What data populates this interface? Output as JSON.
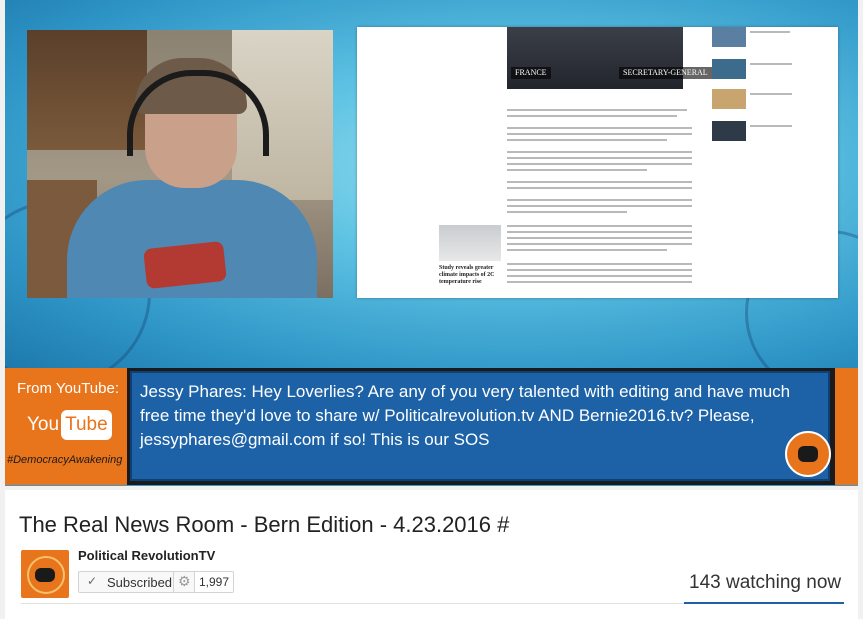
{
  "ticker": {
    "from_label": "From YouTube:",
    "brand_you": "You",
    "brand_tube": "Tube",
    "hashtag": "#DemocracyAwakening",
    "message": "Jessy Phares: Hey Loverlies? Are any of you very talented with editing and have much free time they'd love to share w/ Politicalrevolution.tv AND Bernie2016.tv? Please, jessyphares@gmail.com if so! This is our SOS"
  },
  "article": {
    "photo_tags": [
      "FRANCE",
      "SECRETARY-GENERAL"
    ],
    "thumb_caption": "Study reveals greater climate impacts of 2C temperature rise"
  },
  "video_info": {
    "title": "The Real News Room - Bern Edition - 4.23.2016 #",
    "channel_name": "Political RevolutionTV",
    "subscribe_label": "Subscribed",
    "subscriber_count": "1,997",
    "watching": "143 watching now"
  },
  "icons": {
    "check": "check-icon",
    "gear": "gear-icon"
  },
  "colors": {
    "brand_orange": "#e8741c",
    "ticker_blue": "#1d62a7"
  }
}
